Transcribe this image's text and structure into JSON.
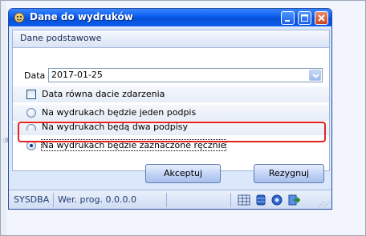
{
  "window": {
    "title": "Dane do wydruków",
    "controls": [
      "minimize-icon",
      "maximize-icon",
      "close-icon"
    ]
  },
  "tab": {
    "label": "Dane podstawowe"
  },
  "form": {
    "date_label": "Data",
    "date_value": "2017-01-25",
    "checkbox_label": "Data równa dacie zdarzenia",
    "checkbox_checked": false,
    "radio_options": [
      {
        "label": "Na wydrukach będzie jeden podpis",
        "selected": false
      },
      {
        "label": "Na wydrukach będą dwa podpisy",
        "selected": false
      },
      {
        "label": "Na wydrukach będzie zaznaczone ręcznie",
        "selected": true
      }
    ]
  },
  "buttons": {
    "accept": "Akceptuj",
    "cancel": "Rezygnuj"
  },
  "status": {
    "user": "SYSDBA",
    "version": "Wer. prog. 0.0.0.0",
    "icons": [
      "grid-icon",
      "database-icon",
      "gear-icon",
      "exit-icon"
    ]
  },
  "colors": {
    "titlebar": "#0a5cf0",
    "highlight_box": "#e32222",
    "dialog_bg": "#dbe7fb"
  }
}
